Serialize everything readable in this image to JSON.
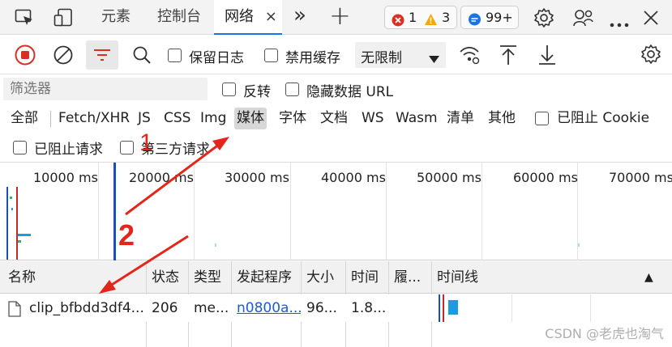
{
  "tabs": {
    "elements_label": "元素",
    "console_label": "控制台",
    "network_label": "网络",
    "close_glyph": "×",
    "more_glyph": "»",
    "add_glyph": "+"
  },
  "badges": {
    "errors": "1",
    "warnings": "3",
    "messages": "99+"
  },
  "toolbar": {
    "preserve_log_label": "保留日志",
    "disable_cache_label": "禁用缓存",
    "throttling_value": "无限制"
  },
  "filter": {
    "placeholder": "筛选器",
    "invert_label": "反转",
    "hide_data_urls_label": "隐藏数据 URL"
  },
  "types": [
    "全部",
    "Fetch/XHR",
    "JS",
    "CSS",
    "Img",
    "媒体",
    "字体",
    "文档",
    "WS",
    "Wasm",
    "清单",
    "其他"
  ],
  "blocked_cookies_label": "已阻止 Cookie",
  "blocked_requests_label": "已阻止请求",
  "third_party_label": "第三方请求",
  "overview": {
    "ticks": [
      "10000 ms",
      "20000 ms",
      "30000 ms",
      "40000 ms",
      "50000 ms",
      "60000 ms",
      "70000 ms"
    ]
  },
  "table": {
    "headers": [
      "名称",
      "状态",
      "类型",
      "发起程序",
      "大小",
      "时间",
      "履...",
      "时间线"
    ],
    "sort_glyph": "▲",
    "rows": [
      {
        "name": "clip_bfbdd3df4...",
        "status": "206",
        "type": "me...",
        "initiator": "n0800a...",
        "size": "96...",
        "time": "1.8..."
      }
    ]
  },
  "annotations": {
    "label1": "1",
    "label2": "2"
  },
  "watermark": "CSDN @老虎也淘气",
  "colors": {
    "accent": "#1a73e8",
    "record_red": "#d93025",
    "annotation_red": "#e3261c",
    "error_red": "#d93025",
    "warning_yellow": "#f2a900",
    "info_blue": "#1a73e8"
  }
}
